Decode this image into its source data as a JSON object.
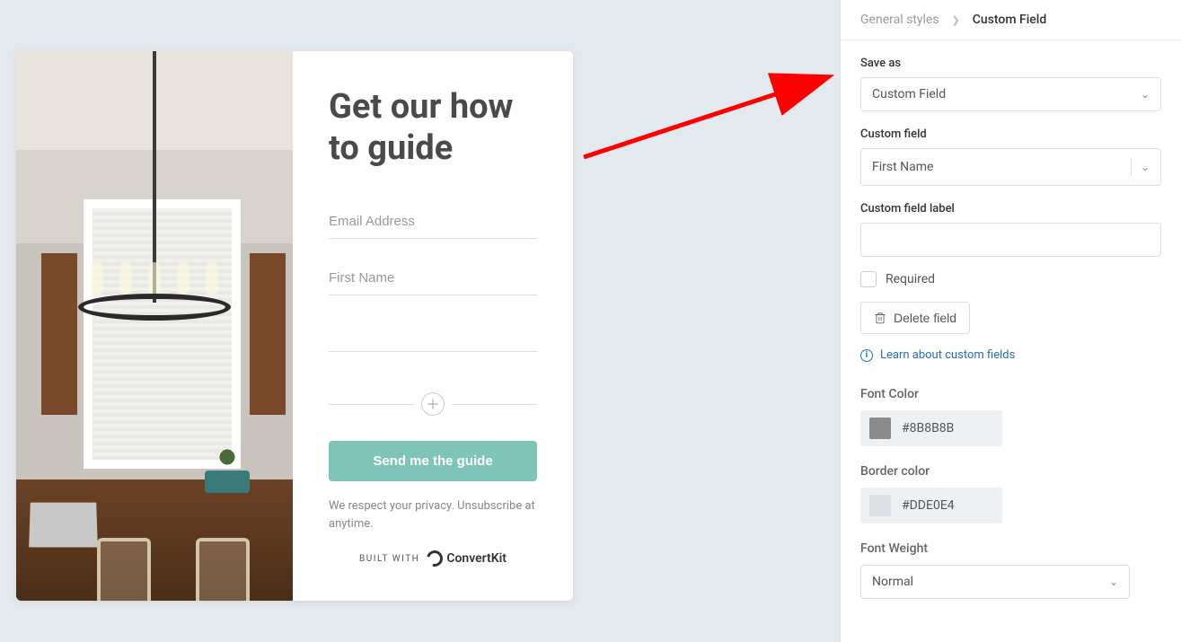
{
  "form": {
    "title": "Get our how to guide",
    "fields": {
      "email_placeholder": "Email Address",
      "firstname_placeholder": "First Name"
    },
    "submit_label": "Send me the guide",
    "privacy_text": "We respect your privacy. Unsubscribe at anytime.",
    "built_with_prefix": "BUILT WITH",
    "built_with_brand": "ConvertKit"
  },
  "sidebar": {
    "breadcrumb": {
      "parent": "General styles",
      "current": "Custom Field"
    },
    "save_as": {
      "label": "Save as",
      "value": "Custom Field"
    },
    "custom_field": {
      "label": "Custom field",
      "value": "First Name"
    },
    "custom_field_label": {
      "label": "Custom field label",
      "value": ""
    },
    "required": {
      "label": "Required",
      "checked": false
    },
    "delete_label": "Delete field",
    "learn_link": "Learn about custom fields",
    "font_color": {
      "label": "Font Color",
      "value": "#8B8B8B"
    },
    "border_color": {
      "label": "Border color",
      "value": "#DDE0E4"
    },
    "font_weight": {
      "label": "Font Weight",
      "value": "Normal"
    }
  }
}
